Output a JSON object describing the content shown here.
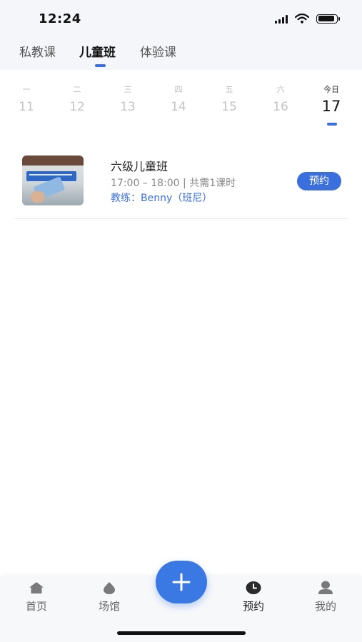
{
  "status_bar": {
    "time": "12:24"
  },
  "top_tabs": [
    {
      "label": "私教课",
      "active": false
    },
    {
      "label": "儿童班",
      "active": true
    },
    {
      "label": "体验课",
      "active": false
    }
  ],
  "week": [
    {
      "weekday": "一",
      "date": "11"
    },
    {
      "weekday": "二",
      "date": "12"
    },
    {
      "weekday": "三",
      "date": "13"
    },
    {
      "weekday": "四",
      "date": "14"
    },
    {
      "weekday": "五",
      "date": "15"
    },
    {
      "weekday": "六",
      "date": "16"
    },
    {
      "weekday": "今日",
      "date": "17",
      "today": true
    }
  ],
  "course": {
    "title": "六级儿童班",
    "time": "17:00 – 18:00 | 共需1课时",
    "coach": "教练：Benny（班尼）",
    "book_label": "预约"
  },
  "tabbar": {
    "items": [
      {
        "label": "首页",
        "icon": "home-icon"
      },
      {
        "label": "场馆",
        "icon": "venue-drop-icon"
      },
      {
        "label": "预约",
        "icon": "clock-icon",
        "active": true
      },
      {
        "label": "我的",
        "icon": "user-icon"
      }
    ],
    "fab_icon": "plus-icon"
  },
  "colors": {
    "accent": "#3b6fdc",
    "fab": "#3a78e4",
    "header_bg": "#f4f6fa"
  }
}
